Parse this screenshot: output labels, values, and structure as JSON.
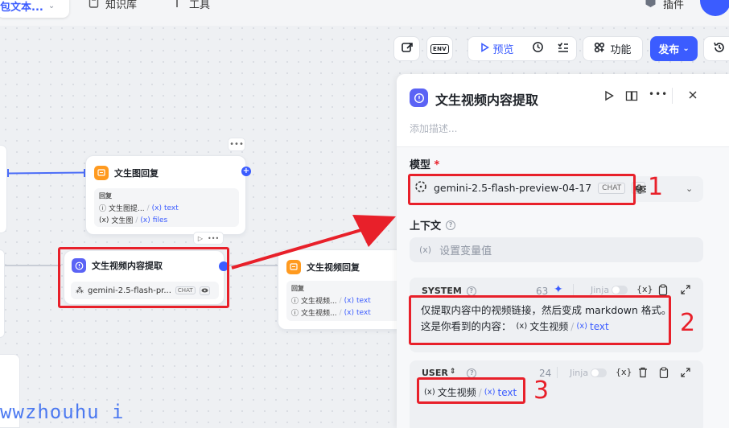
{
  "topbar": {
    "project_name": "包文本...",
    "nav_knowledge": "知识库",
    "nav_tools": "工具",
    "nav_plugins": "插件"
  },
  "toolbar": {
    "env_label": "ENV",
    "preview_label": "预览",
    "features_label": "功能",
    "publish_label": "发布"
  },
  "canvas": {
    "node_image_reply": {
      "title": "文生图回复",
      "section_label": "回复",
      "rows": [
        {
          "icon": "ⓘ",
          "name": "文生图提...",
          "type": "text"
        },
        {
          "icon": "(x)",
          "name": "文生图",
          "type": "files"
        }
      ]
    },
    "node_video_extract": {
      "title": "文生视频内容提取",
      "model": "gemini-2.5-flash-pr...",
      "chat_tag": "CHAT"
    },
    "node_video_reply": {
      "title": "文生视频回复",
      "section_label": "回复",
      "rows": [
        {
          "icon": "ⓘ",
          "name": "文生视频...",
          "type": "text"
        },
        {
          "icon": "ⓘ",
          "name": "文生视频...",
          "type": "text"
        }
      ]
    }
  },
  "panel": {
    "title": "文生视频内容提取",
    "description_placeholder": "添加描述...",
    "model_label": "模型",
    "required_mark": "*",
    "model_name": "gemini-2.5-flash-preview-04-17",
    "chat_tag": "CHAT",
    "context_label": "上下文",
    "variable_placeholder": "设置变量值",
    "system": {
      "label": "SYSTEM",
      "token_count": "63",
      "jinja_label": "Jinja",
      "text_line1": "仅提取内容中的视频链接，然后变成 markdown 格式。",
      "text_line2_prefix": "这是你看到的内容：",
      "var_name": "文生视频",
      "var_type": "text"
    },
    "user": {
      "label": "USER",
      "token_count": "24",
      "jinja_label": "Jinja",
      "var_name": "文生视频",
      "var_type": "text"
    }
  },
  "annotations": {
    "label_1": "1",
    "label_2": "2",
    "label_3": "3"
  },
  "watermark": "wwzhouhu i",
  "colors": {
    "accent": "#3b5cff",
    "annotation_red": "#e8202a"
  }
}
